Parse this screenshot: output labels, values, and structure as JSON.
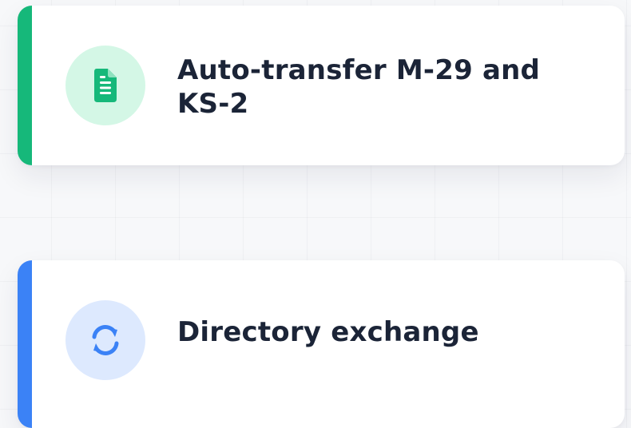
{
  "cards": [
    {
      "title": "Auto-transfer M-29 and KS-2",
      "icon": "document-icon",
      "accent_color": "#16b87a",
      "icon_bg": "#d4f7e6"
    },
    {
      "title": "Directory exchange",
      "icon": "sync-icon",
      "accent_color": "#3b82f6",
      "icon_bg": "#dde9fe"
    }
  ]
}
